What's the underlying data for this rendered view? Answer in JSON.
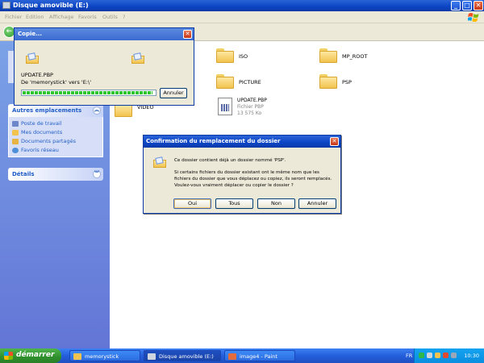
{
  "window": {
    "title": "Disque amovible (E:)",
    "buttons": {
      "minimize": "_",
      "maximize": "□",
      "close": "✕"
    }
  },
  "menu": [
    "Fichier",
    "Edition",
    "Affichage",
    "Favoris",
    "Outils",
    "?"
  ],
  "leftpane": {
    "other_places": {
      "title": "Autres emplacements",
      "items": [
        "Poste de travail",
        "Mes documents",
        "Documents partagés",
        "Favoris réseau"
      ]
    },
    "details": {
      "title": "Détails"
    }
  },
  "content": {
    "folders": [
      "ISO",
      "MP_ROOT",
      "PICTURE",
      "PSP",
      "VIDEO"
    ],
    "file": {
      "name": "UPDATE.PBP",
      "type": "Fichier PBP",
      "size": "13 575 Ko"
    }
  },
  "copy_dialog": {
    "title": "Copie...",
    "filename": "UPDATE.PBP",
    "fromto": "De 'memorystick' vers 'E:\\'",
    "cancel": "Annuler",
    "progress": 0.98
  },
  "confirm_dialog": {
    "title": "Confirmation du remplacement du dossier",
    "line1": "Ce dossier contient déjà un dossier nommé 'PSP'.",
    "line2": "Si certains fichiers du dossier existant ont le même nom que les",
    "line3": "fichiers du dossier que vous déplacez ou copiez, ils seront remplacés.",
    "line4": "Voulez-vous vraiment déplacer ou copier le dossier ?",
    "buttons": [
      "Oui",
      "Tous",
      "Non",
      "Annuler"
    ]
  },
  "taskbar": {
    "start": "démarrer",
    "tasks": [
      "memorystick",
      "Disque amovible (E:)",
      "image4 - Paint"
    ],
    "lang": "FR",
    "clock": "10:30"
  }
}
